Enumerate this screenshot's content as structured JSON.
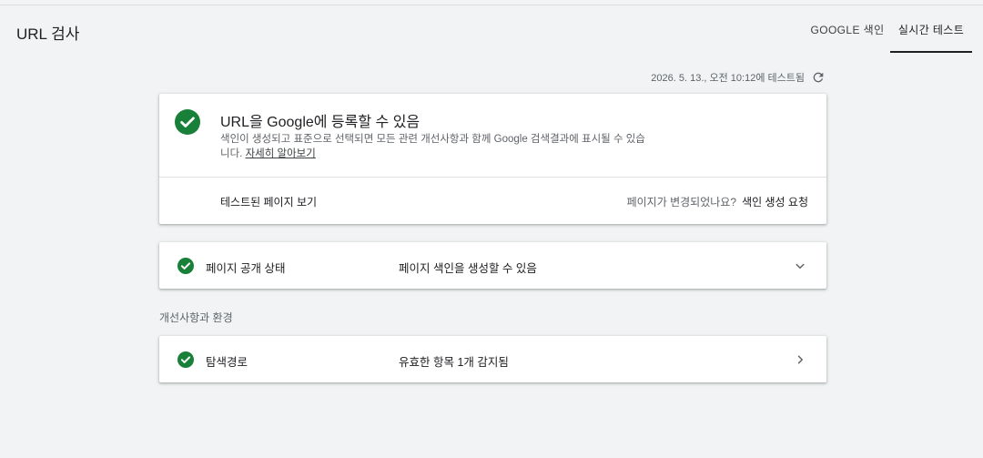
{
  "header": {
    "title": "URL 검사",
    "tabs": [
      {
        "label": "GOOGLE 색인",
        "active": false
      },
      {
        "label": "실시간 테스트",
        "active": true
      }
    ]
  },
  "test_info": {
    "tested_text": "2026. 5. 13., 오전 10:12에 테스트됨",
    "refresh_icon": "refresh-icon"
  },
  "summary_card": {
    "status_icon": "check-circle-icon",
    "status_color": "#188038",
    "title": "URL을 Google에 등록할 수 있음",
    "description_line1": "색인이 생성되고 표준으로 선택되면 모든 관련 개선사항과 함께 Google 검색결과에 표시될 수 있습",
    "description_line2": "니다.",
    "learn_more": "자세히 알아보기",
    "view_tested_page": "테스트된 페이지 보기",
    "page_changed_question": "페이지가 변경되었나요?",
    "request_indexing": "색인 생성 요청"
  },
  "availability_row": {
    "label": "페이지 공개 상태",
    "value": "페이지 색인을 생성할 수 있음",
    "expand_icon": "chevron-down-icon"
  },
  "enhancements": {
    "section_label": "개선사항과 환경",
    "rows": [
      {
        "label": "탐색경로",
        "value": "유효한 항목 1개 감지됨",
        "icon": "chevron-right-icon"
      }
    ]
  }
}
